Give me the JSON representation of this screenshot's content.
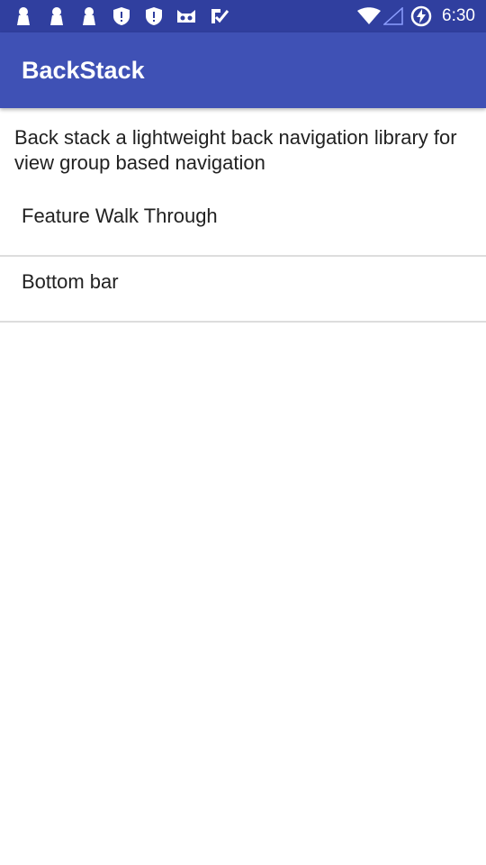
{
  "status_bar": {
    "time": "6:30",
    "left_icons": [
      "notification-icon",
      "notification-icon",
      "notification-icon",
      "shield-icon",
      "shield-icon",
      "cat-icon",
      "check-icon"
    ],
    "right_icons": [
      "wifi-icon",
      "signal-icon",
      "battery-charging-icon"
    ],
    "color": "#303f9f"
  },
  "app_bar": {
    "title": "BackStack",
    "color": "#3f51b5"
  },
  "main": {
    "description": "Back stack a lightweight back navigation library for view group based navigation",
    "items": [
      {
        "label": "Feature Walk Through"
      },
      {
        "label": "Bottom bar"
      }
    ]
  }
}
